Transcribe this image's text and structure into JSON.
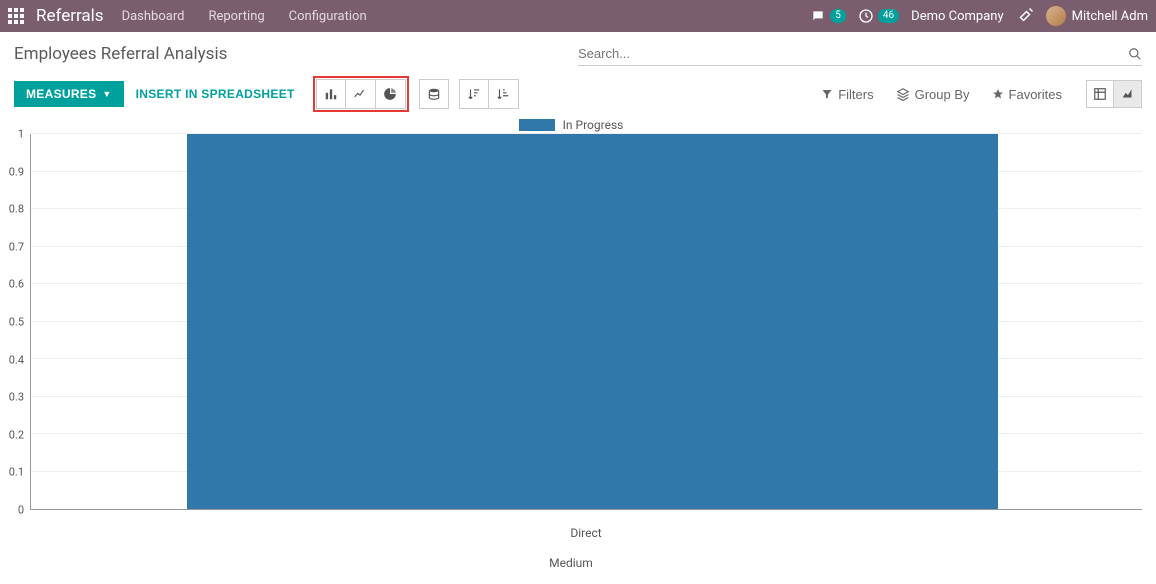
{
  "topbar": {
    "brand": "Referrals",
    "nav": [
      "Dashboard",
      "Reporting",
      "Configuration"
    ],
    "messages_count": "5",
    "activities_count": "46",
    "company": "Demo Company",
    "user_name": "Mitchell Adm"
  },
  "page": {
    "title": "Employees Referral Analysis",
    "search_placeholder": "Search..."
  },
  "toolbar": {
    "measures_label": "MEASURES",
    "insert_label": "INSERT IN SPREADSHEET",
    "filters_label": "Filters",
    "groupby_label": "Group By",
    "favorites_label": "Favorites"
  },
  "chart_data": {
    "type": "bar",
    "categories": [
      "Direct"
    ],
    "series": [
      {
        "name": "In Progress",
        "values": [
          1
        ],
        "color": "#3077aa"
      }
    ],
    "xlabel": "Medium",
    "ylabel": "",
    "ylim": [
      0,
      1
    ],
    "yticks": [
      0,
      0.1,
      0.2,
      0.3,
      0.4,
      0.5,
      0.6,
      0.7,
      0.8,
      0.9,
      1
    ],
    "legend_position": "top"
  }
}
